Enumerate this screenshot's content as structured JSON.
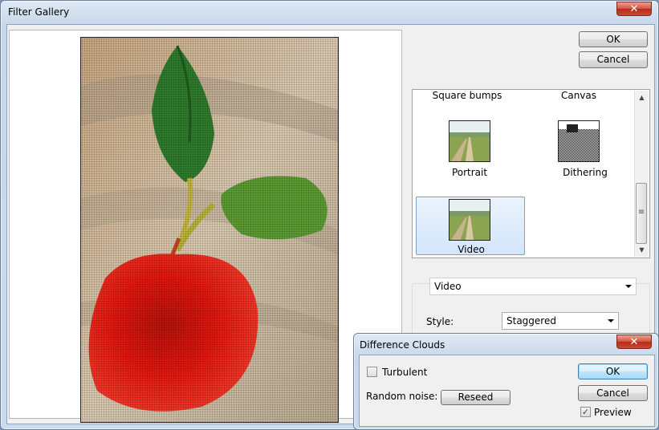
{
  "main_window": {
    "title": "Filter Gallery",
    "close_glyph": "✕",
    "ok_label": "OK",
    "cancel_label": "Cancel"
  },
  "gallery": {
    "top_row_labels": [
      "Square bumps",
      "Canvas"
    ],
    "items": [
      {
        "label": "Portrait",
        "thumb_style": "landscape-photo"
      },
      {
        "label": "Dithering",
        "thumb_style": "dithered-photo"
      },
      {
        "label": "Video",
        "thumb_style": "landscape-photo",
        "selected": true
      }
    ],
    "scroll_up_glyph": "▲",
    "scroll_down_glyph": "▼",
    "scroll_grip_glyph": "≡"
  },
  "settings": {
    "filter_select_value": "Video",
    "style_label": "Style:",
    "style_select_value": "Staggered"
  },
  "clouds_dialog": {
    "title": "Difference Clouds",
    "close_glyph": "✕",
    "turbulent_label": "Turbulent",
    "turbulent_checked": false,
    "random_noise_label": "Random noise:",
    "reseed_label": "Reseed",
    "ok_label": "OK",
    "cancel_label": "Cancel",
    "preview_label": "Preview",
    "preview_checked": true,
    "check_glyph": "✓"
  },
  "colors": {
    "apple_red": "#e2160e",
    "leaf_green": "#4e9a2e",
    "canvas_beige": "#cdb89a",
    "selection_blue": "#d3e6fb",
    "close_red": "#c84a32"
  }
}
